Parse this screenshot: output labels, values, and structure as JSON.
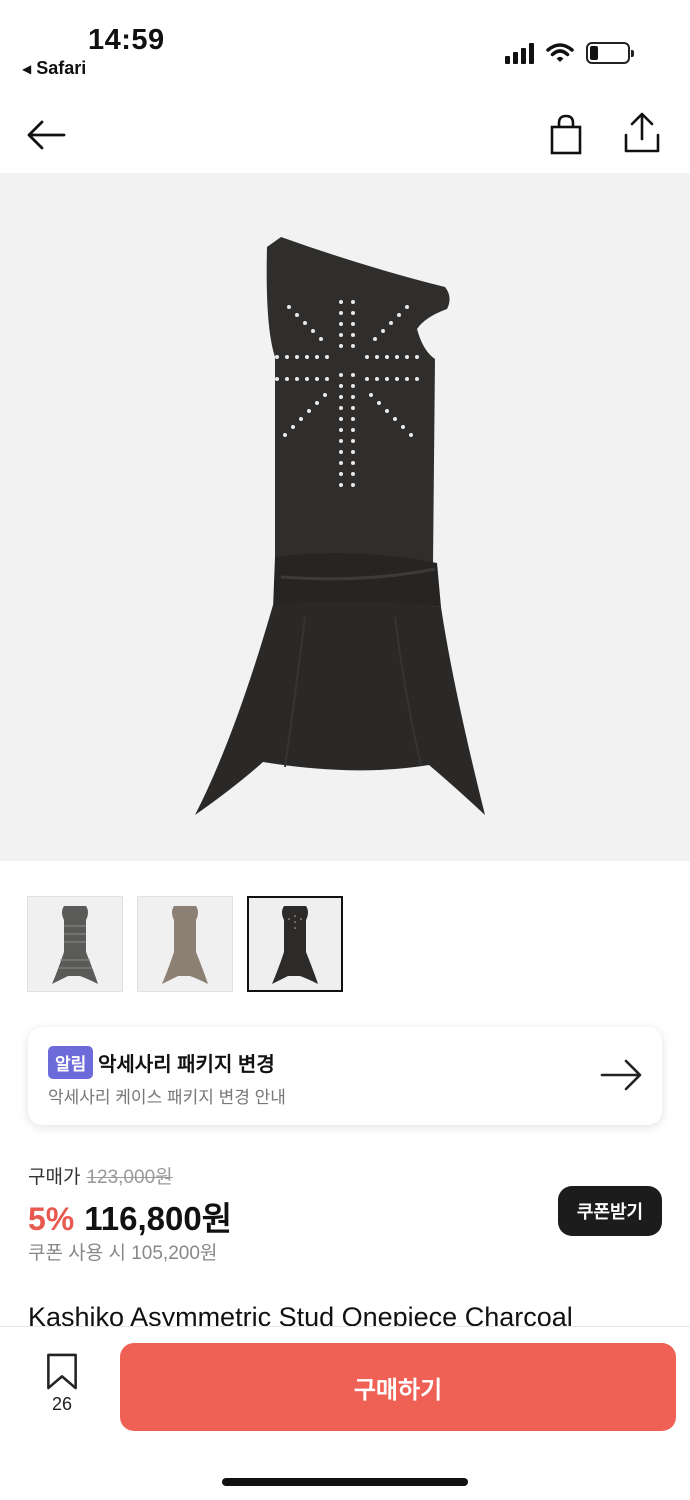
{
  "status": {
    "time": "14:59",
    "back_app": "Safari"
  },
  "nav": {
    "icons": [
      "arrow-left-icon",
      "shopping-bag-icon",
      "share-icon"
    ]
  },
  "gallery": {
    "thumbnail_count": 3,
    "selected_index": 2
  },
  "notice": {
    "badge": "알림",
    "title": "악세사리 패키지 변경",
    "subtitle": "악세사리 케이스 패키지 변경 안내"
  },
  "price": {
    "label": "구매가",
    "original": "123,000원",
    "discount": "5%",
    "sale": "116,800원",
    "coupon_text": "쿠폰 사용 시 105,200원",
    "coupon_button": "쿠폰받기"
  },
  "product": {
    "name": "Kashiko Asymmetric Stud Onepiece Charcoal"
  },
  "bottom": {
    "bookmark_count": "26",
    "buy_label": "구매하기"
  },
  "colors": {
    "accent": "#ef6155",
    "discount": "#e85a4f",
    "badge": "#6c6bd9",
    "dark_button": "#1c1c1c"
  }
}
